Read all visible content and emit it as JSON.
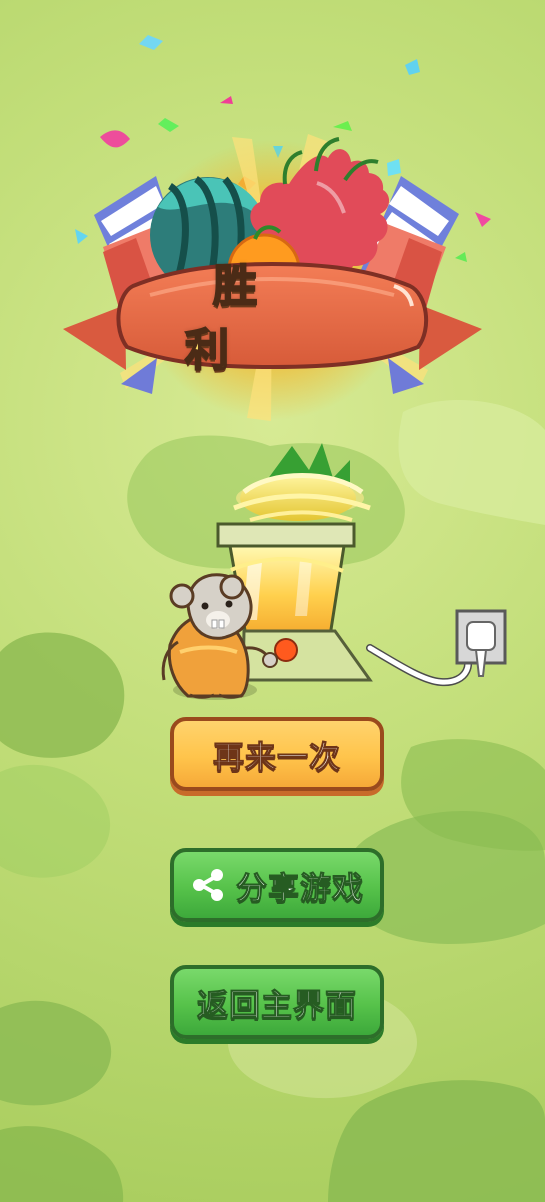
{
  "screen": {
    "title": "胜 利",
    "buttons": {
      "retry_label": "再来一次",
      "share_label": "分享游戏",
      "home_label": "返回主界面"
    },
    "icons": {
      "share": "share-icon"
    },
    "colors": {
      "background": "#bcd86f",
      "ribbon": "#e46a45",
      "button_orange": "#ffc44b",
      "button_green": "#56c24a"
    }
  }
}
